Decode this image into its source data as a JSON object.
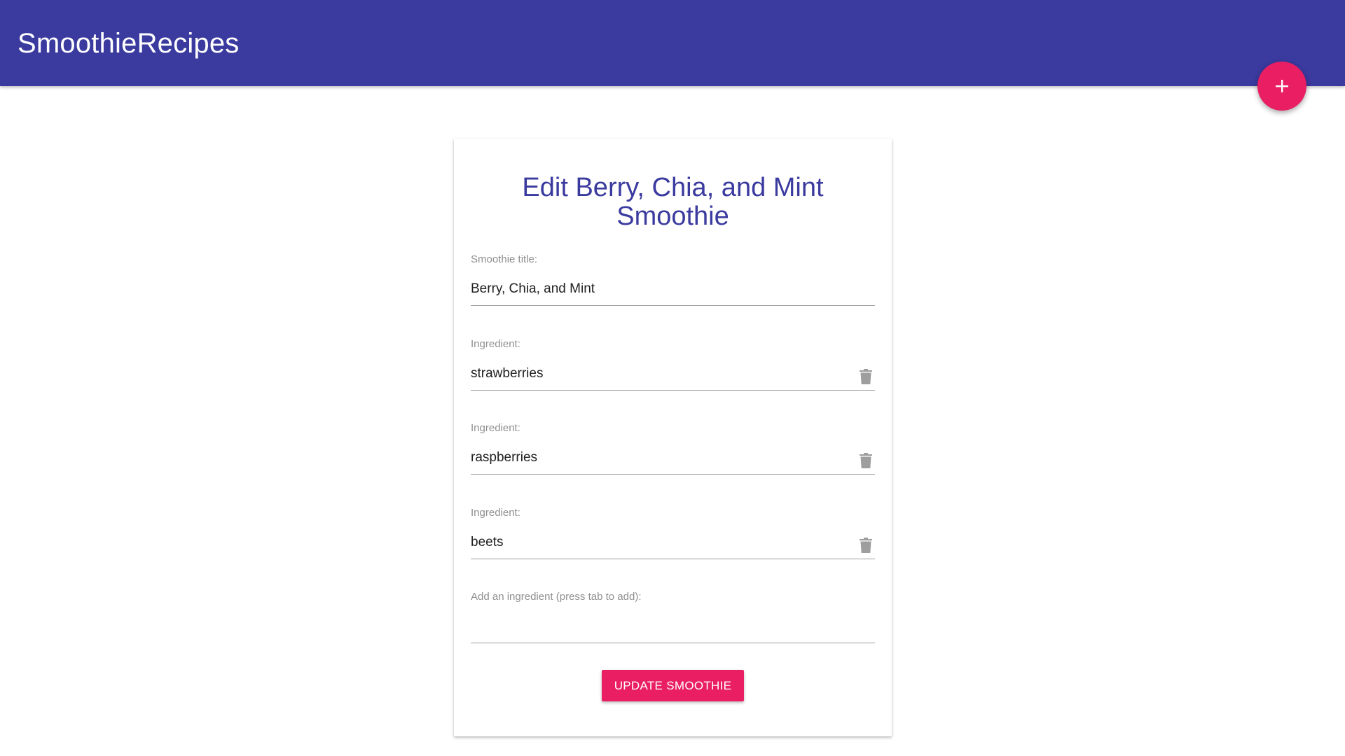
{
  "navbar": {
    "brand": "SmoothieRecipes",
    "color": "#3a3a9f"
  },
  "fab": {
    "icon": "plus-icon",
    "color": "#e91e63"
  },
  "form": {
    "heading": "Edit Berry, Chia, and Mint Smoothie",
    "title_field": {
      "label": "Smoothie title:",
      "value": "Berry, Chia, and Mint"
    },
    "ingredients": [
      {
        "label": "Ingredient:",
        "value": "strawberries",
        "delete_icon": "trash-icon"
      },
      {
        "label": "Ingredient:",
        "value": "raspberries",
        "delete_icon": "trash-icon"
      },
      {
        "label": "Ingredient:",
        "value": "beets",
        "delete_icon": "trash-icon"
      }
    ],
    "new_ingredient": {
      "label": "Add an ingredient (press tab to add):",
      "value": ""
    },
    "submit_label": "UPDATE SMOOTHIE",
    "accent_color": "#e91e63"
  }
}
